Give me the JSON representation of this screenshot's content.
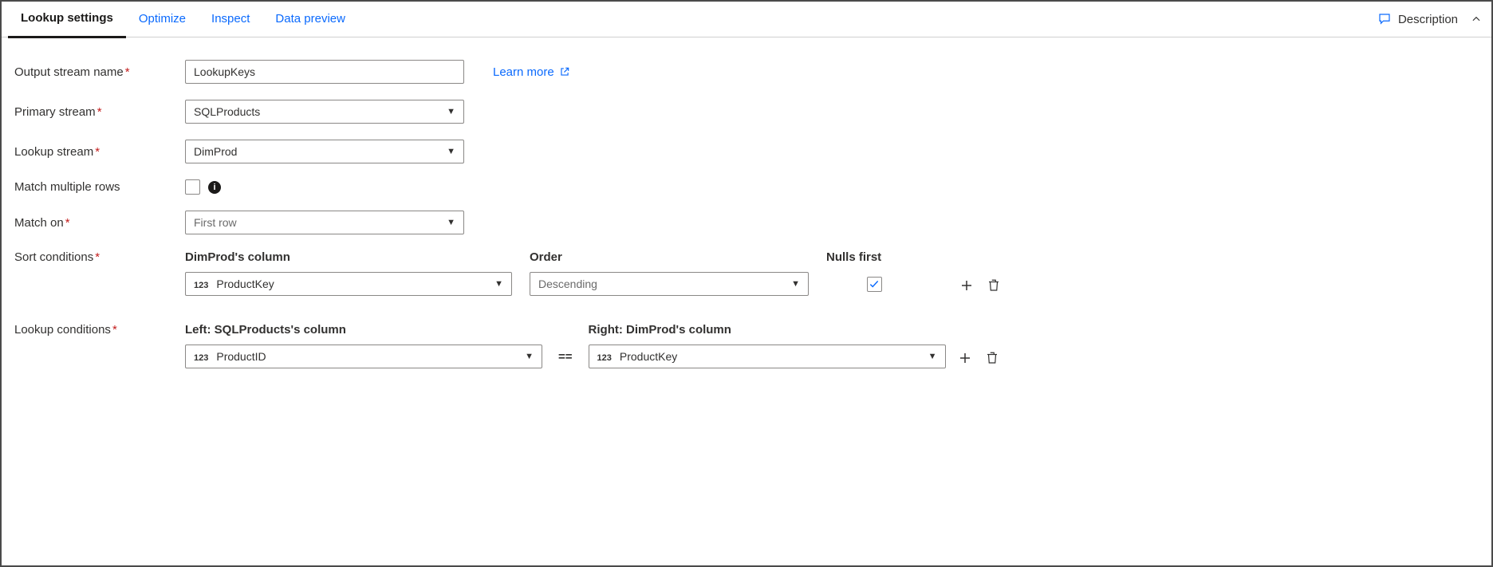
{
  "tabs": {
    "lookup": "Lookup settings",
    "optimize": "Optimize",
    "inspect": "Inspect",
    "preview": "Data preview"
  },
  "header": {
    "description_label": "Description"
  },
  "form": {
    "output_stream_label": "Output stream name",
    "output_stream_value": "LookupKeys",
    "learn_more": "Learn more",
    "primary_stream_label": "Primary stream",
    "primary_stream_value": "SQLProducts",
    "lookup_stream_label": "Lookup stream",
    "lookup_stream_value": "DimProd",
    "match_multiple_label": "Match multiple rows",
    "match_multiple_checked": false,
    "match_on_label": "Match on",
    "match_on_value": "First row"
  },
  "sort": {
    "label": "Sort conditions",
    "col_header": "DimProd's column",
    "order_header": "Order",
    "nulls_header": "Nulls first",
    "col_type": "123",
    "col_value": "ProductKey",
    "order_value": "Descending",
    "nulls_first_checked": true
  },
  "lookup": {
    "label": "Lookup conditions",
    "left_header": "Left: SQLProducts's column",
    "right_header": "Right: DimProd's column",
    "left_type": "123",
    "left_value": "ProductID",
    "operator": "==",
    "right_type": "123",
    "right_value": "ProductKey"
  },
  "colors": {
    "link": "#0b6afd",
    "required": "#c31c1c"
  }
}
